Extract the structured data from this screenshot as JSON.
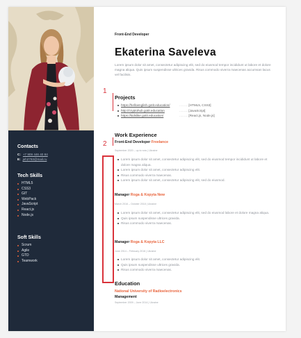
{
  "header": {
    "role": "Front-End Developer",
    "name": "Ekaterina Saveleva",
    "intro": "Lorem ipsum dolor sit amet, consectetur adipiscing elit, sed do eiusmod tempor incididunt ut labore et dolore magna aliqua. Quis ipsum suspendisse ultrices gravida. Risus commodo viverra maecenas accumsan lacus vel facilisis."
  },
  "sidebar": {
    "contacts": {
      "title": "Contacts",
      "phone_label": "C:",
      "phone": "+7 909 446 40 84",
      "email_label": "E:",
      "email": "jeh2793@mail.ru"
    },
    "tech_skills": {
      "title": "Tech Skills",
      "items": [
        "HTML5",
        "CSS3",
        "GIT",
        "WebPack",
        "JavaScript",
        "React.js",
        "Node.js"
      ]
    },
    "soft_skills": {
      "title": "Soft Skills",
      "items": [
        "Scrum",
        "Agile",
        "GTD",
        "Teamwork"
      ]
    }
  },
  "projects": {
    "title": "Projects",
    "items": [
      {
        "link": "https://helloenglish.gotit.education/",
        "tech": "[HTML5, CSS3]"
      },
      {
        "link": "http://cryptohub.gotit.education",
        "tech": "[JavaScript]"
      },
      {
        "link": "https://kidslike.gotit.education/",
        "tech": "[React.js, Node.js]"
      }
    ]
  },
  "experience": {
    "title": "Work Experience",
    "jobs": [
      {
        "title": "Front-End Developer",
        "company": "Freelance",
        "meta": "September 2020 – up to now | Ukraine",
        "bullets": [
          "Lorem ipsum dolor sit amet, consectetur adipiscing elit, sed do eiusmod tempor incididunt ut labore et dolore magna aliqua.",
          "Lorem ipsum dolor sit amet, consectetur adipiscing elit.",
          "Risus commodo viverra maecenas.",
          "Lorem ipsum dolor sit amet, consectetur adipiscing elit, sed do eiusmod."
        ]
      },
      {
        "title": "Manager",
        "company": "Roga & Kopyta New",
        "meta": "March 2016 – October 2018 | Ukraine",
        "bullets": [
          "Lorem ipsum dolor sit amet, consectetur adipiscing elit, sed do eiusmod labore et dolore magna aliqua.",
          "Quis ipsum suspendisse ultrices gravida.",
          "Risus commodo viverra maecenas."
        ]
      },
      {
        "title": "Manager",
        "company": "Roga & Kopyta LLC",
        "meta": "June 2014 – February 2016 | Ukraine",
        "bullets": [
          "Lorem ipsum dolor sit amet, consectetur adipiscing elit.",
          "Quis ipsum suspendisse ultrices gravida.",
          "Risus commodo viverra maecenas."
        ]
      }
    ]
  },
  "education": {
    "title": "Education",
    "school": "National University of Radioelectronics",
    "degree": "Management",
    "meta": "September 2009 – June 2014 | Ukraine"
  },
  "annotations": {
    "marker_1": "1",
    "marker_2": "2",
    "color": "#d9323a"
  },
  "colors": {
    "sidebar": "#1f2a3a",
    "accent": "#e8643c"
  }
}
